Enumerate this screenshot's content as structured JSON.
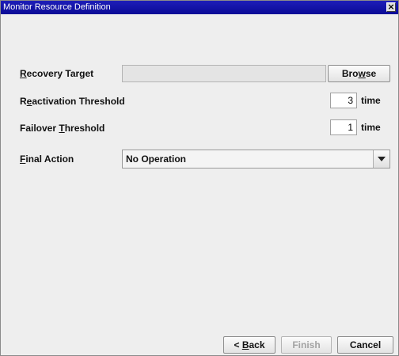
{
  "window": {
    "title": "Monitor Resource Definition",
    "close_glyph": "×"
  },
  "form": {
    "recovery_target": {
      "label_before": "",
      "label_mnemonic": "R",
      "label_after": "ecovery Target",
      "value": "",
      "browse_before": "Bro",
      "browse_mnemonic": "w",
      "browse_after": "se"
    },
    "reactivation_threshold": {
      "label_before": "R",
      "label_mnemonic": "e",
      "label_after": "activation Threshold",
      "value": "3",
      "unit": "time"
    },
    "failover_threshold": {
      "label_before": "Failover ",
      "label_mnemonic": "T",
      "label_after": "hreshold",
      "value": "1",
      "unit": "time"
    },
    "final_action": {
      "label_before": "",
      "label_mnemonic": "F",
      "label_after": "inal Action",
      "selected": "No Operation"
    }
  },
  "footer": {
    "back_before": "< ",
    "back_mnemonic": "B",
    "back_after": "ack",
    "finish": "Finish",
    "cancel": "Cancel"
  },
  "icons": {
    "close": "close-icon",
    "dropdown": "chevron-down-icon"
  }
}
